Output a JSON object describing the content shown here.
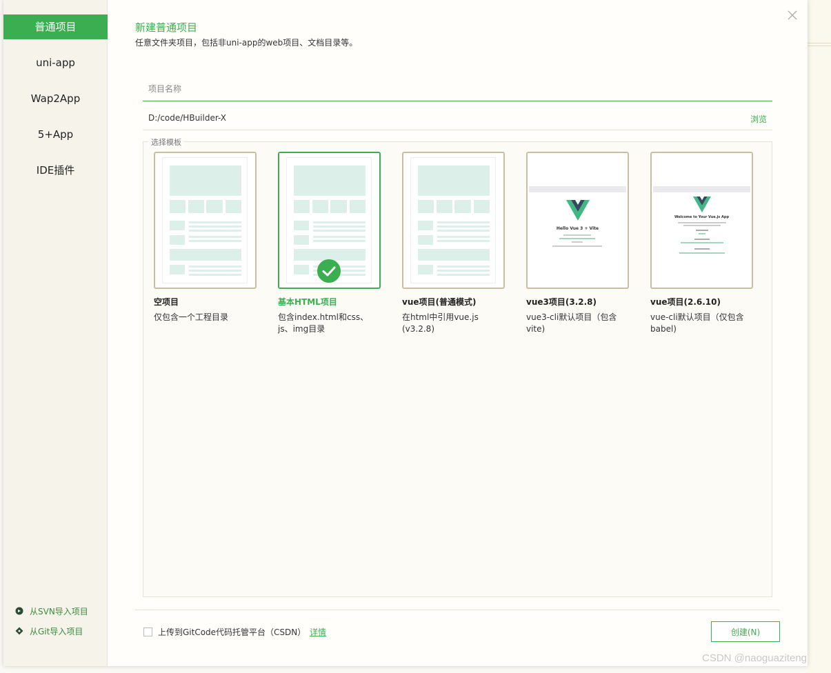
{
  "sidebar": {
    "items": [
      {
        "label": "普通项目",
        "active": true
      },
      {
        "label": "uni-app",
        "active": false
      },
      {
        "label": "Wap2App",
        "active": false
      },
      {
        "label": "5+App",
        "active": false
      },
      {
        "label": "IDE插件",
        "active": false
      }
    ],
    "svn_import": "从SVN导入项目",
    "git_import": "从Git导入项目"
  },
  "header": {
    "title": "新建普通项目",
    "subtitle": "任意文件夹项目，包括非uni-app的web项目、文档目录等。"
  },
  "form": {
    "project_name_placeholder": "项目名称",
    "project_name_value": "",
    "location": "D:/code/HBuilder-X",
    "browse_label": "浏览"
  },
  "templates": {
    "legend": "选择模板",
    "selected_index": 1,
    "items": [
      {
        "name": "空项目",
        "description": "仅包含一个工程目录",
        "thumbnail": "wireframe"
      },
      {
        "name": "基本HTML项目",
        "description": "包含index.html和css、js、img目录",
        "thumbnail": "wireframe"
      },
      {
        "name": "vue项目(普通模式)",
        "description": "在html中引用vue.js (v3.2.8)",
        "thumbnail": "wireframe"
      },
      {
        "name": "vue3项目(3.2.8)",
        "description": "vue3-cli默认项目（包含vite)",
        "thumbnail": "vue-logo",
        "preview_heading": "Hello Vue 3 + Vite"
      },
      {
        "name": "vue项目(2.6.10)",
        "description": "vue-cli默认项目（仅包含babel)",
        "thumbnail": "vue-logo",
        "preview_heading": "Welcome to Your Vue.js App"
      }
    ]
  },
  "footer": {
    "upload_label": "上传到GitCode代码托管平台（CSDN）",
    "upload_checked": false,
    "details_label": "详情",
    "create_label": "创建(N)"
  },
  "watermark": "CSDN @naoguaziteng",
  "colors": {
    "accent": "#3cae52",
    "card_border": "#c9bfa0",
    "wire_fill": "#dcefe9"
  },
  "icons": {
    "close": "close-icon",
    "svn": "svn-icon",
    "git": "git-icon",
    "check": "check-icon"
  }
}
